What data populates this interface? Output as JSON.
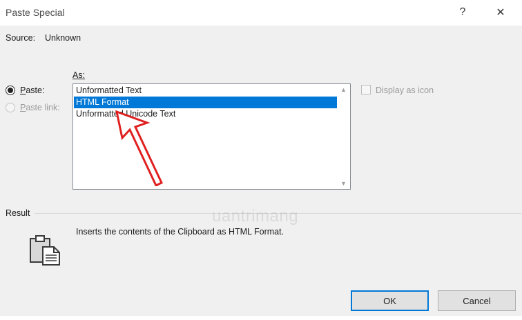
{
  "window": {
    "title": "Paste Special",
    "help_glyph": "?",
    "close_glyph": "✕"
  },
  "source": {
    "label": "Source:",
    "value": "Unknown"
  },
  "as_label": "As:",
  "paste_options": {
    "paste_label": "Paste:",
    "paste_link_label": "Paste link:"
  },
  "formats": {
    "items": [
      "Unformatted Text",
      "HTML Format",
      "Unformatted Unicode Text"
    ],
    "selected_index": 1
  },
  "display_as_icon": {
    "label": "Display as icon",
    "checked": false
  },
  "result": {
    "label": "Result",
    "description": "Inserts the contents of the Clipboard as HTML Format."
  },
  "buttons": {
    "ok": "OK",
    "cancel": "Cancel"
  },
  "watermark": {
    "text": "uantrimang"
  },
  "icons": [
    "help-icon",
    "close-icon",
    "clipboard-icon",
    "scroll-up-icon",
    "scroll-down-icon",
    "red-arrow-annotation"
  ],
  "colors": {
    "selection": "#0078d7",
    "annotation_arrow": "#e02020"
  }
}
